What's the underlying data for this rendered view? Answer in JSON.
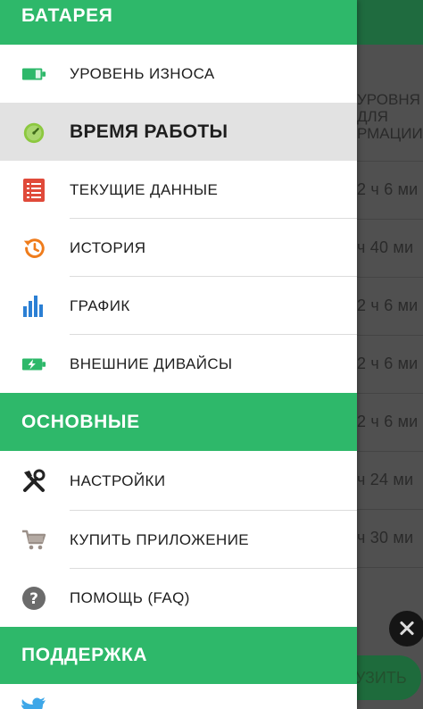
{
  "background": {
    "header_lines": [
      "УРОВНЯ",
      "ДЛЯ",
      "РМАЦИИ..."
    ],
    "rows": [
      "2 ч 6 ми",
      "ч 40 ми",
      "2 ч 6 ми",
      "2 ч 6 ми",
      "2 ч 6 ми",
      "ч 24 ми",
      "ч 30 ми"
    ],
    "button_label": "УЗИТЬ"
  },
  "drawer": {
    "sections": {
      "battery": "БАТАРЕЯ",
      "main": "ОСНОВНЫЕ",
      "support": "ПОДДЕРЖКА"
    },
    "battery_items": [
      {
        "label": "УРОВЕНЬ ИЗНОСА",
        "icon": "battery-level-icon"
      },
      {
        "label": "ВРЕМЯ РАБОТЫ",
        "icon": "stopwatch-icon",
        "active": true
      },
      {
        "label": "ТЕКУЩИЕ ДАННЫЕ",
        "icon": "list-icon"
      },
      {
        "label": "ИСТОРИЯ",
        "icon": "history-icon"
      },
      {
        "label": "ГРАФИК",
        "icon": "bar-chart-icon"
      },
      {
        "label": "ВНЕШНИЕ ДИВАЙСЫ",
        "icon": "battery-charging-icon"
      }
    ],
    "main_items": [
      {
        "label": "НАСТРОЙКИ",
        "icon": "tools-icon"
      },
      {
        "label": "КУПИТЬ ПРИЛОЖЕНИЕ",
        "icon": "cart-icon"
      },
      {
        "label": "ПОМОЩЬ (FAQ)",
        "icon": "help-icon"
      }
    ]
  },
  "colors": {
    "accent_green": "#2eb86a",
    "active_row": "#e2e2e2",
    "icon_red": "#e04a3a",
    "icon_orange": "#ef7c1c",
    "icon_blue": "#2b7fd4"
  }
}
